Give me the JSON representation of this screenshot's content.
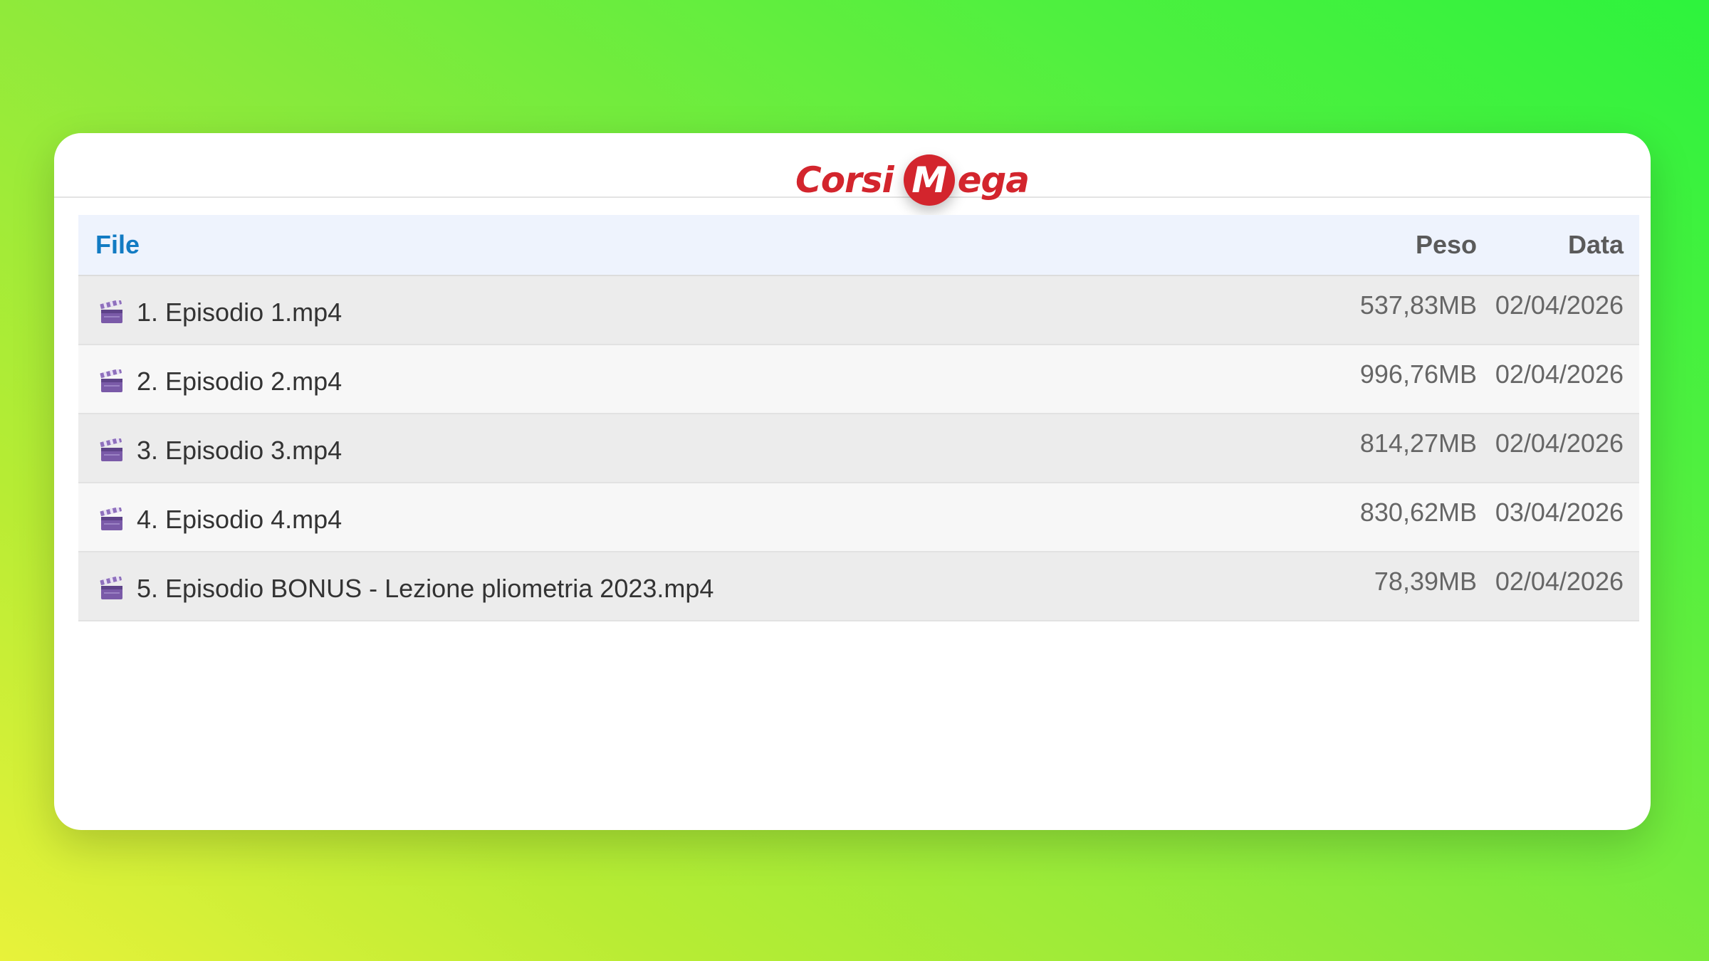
{
  "logo": {
    "text_left": "Corsi",
    "badge_letter": "M",
    "text_right": "ega"
  },
  "table": {
    "headers": {
      "file": "File",
      "size": "Peso",
      "date": "Data"
    },
    "rows": [
      {
        "name": "1. Episodio 1.mp4",
        "size": "537,83MB",
        "date": "02/04/2026",
        "icon": "clapperboard-icon"
      },
      {
        "name": "2. Episodio 2.mp4",
        "size": "996,76MB",
        "date": "02/04/2026",
        "icon": "clapperboard-icon"
      },
      {
        "name": "3. Episodio 3.mp4",
        "size": "814,27MB",
        "date": "02/04/2026",
        "icon": "clapperboard-icon"
      },
      {
        "name": "4. Episodio 4.mp4",
        "size": "830,62MB",
        "date": "03/04/2026",
        "icon": "clapperboard-icon"
      },
      {
        "name": "5. Episodio BONUS - Lezione pliometria 2023.mp4",
        "size": "78,39MB",
        "date": "02/04/2026",
        "icon": "clapperboard-icon"
      }
    ]
  },
  "colors": {
    "brand_red": "#d3252d",
    "header_link": "#127bc3",
    "icon_purple": "#7a5aa8"
  }
}
